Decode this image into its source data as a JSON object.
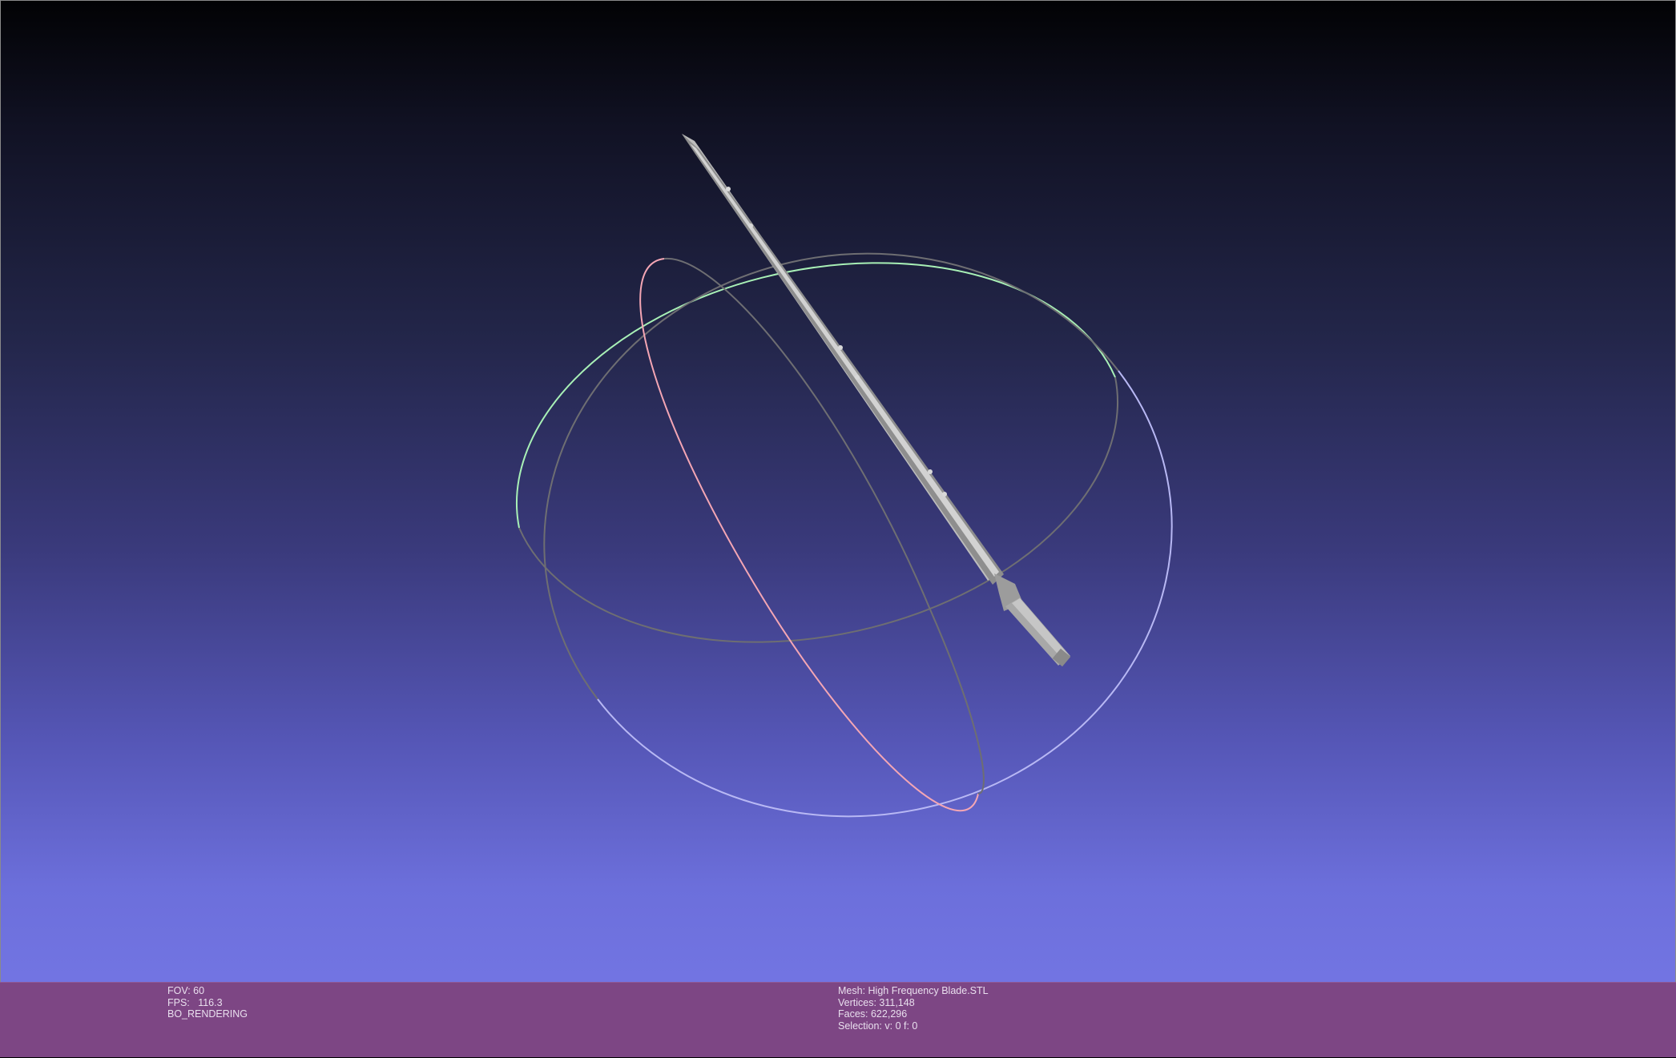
{
  "viewport": {
    "background_top_color": "#020204",
    "background_bottom_color": "#7779e8",
    "info_bar_color": "#7d4684"
  },
  "trackball": {
    "ring_colors": {
      "x_axis": "#f4a6b4",
      "y_axis": "#a8f0b6",
      "z_axis": "#b8b8f4",
      "inactive": "#6e6e72"
    }
  },
  "mesh_render": {
    "object": "blade-model",
    "color": "#a4a4a4"
  },
  "info": {
    "left": {
      "fov": "FOV: 60",
      "fps": "FPS:   116.3",
      "mode": "BO_RENDERING"
    },
    "right": {
      "mesh": "Mesh: High Frequency Blade.STL",
      "vertices": "Vertices: 311,148",
      "faces": "Faces: 622,296",
      "selection": "Selection: v: 0 f: 0"
    }
  }
}
